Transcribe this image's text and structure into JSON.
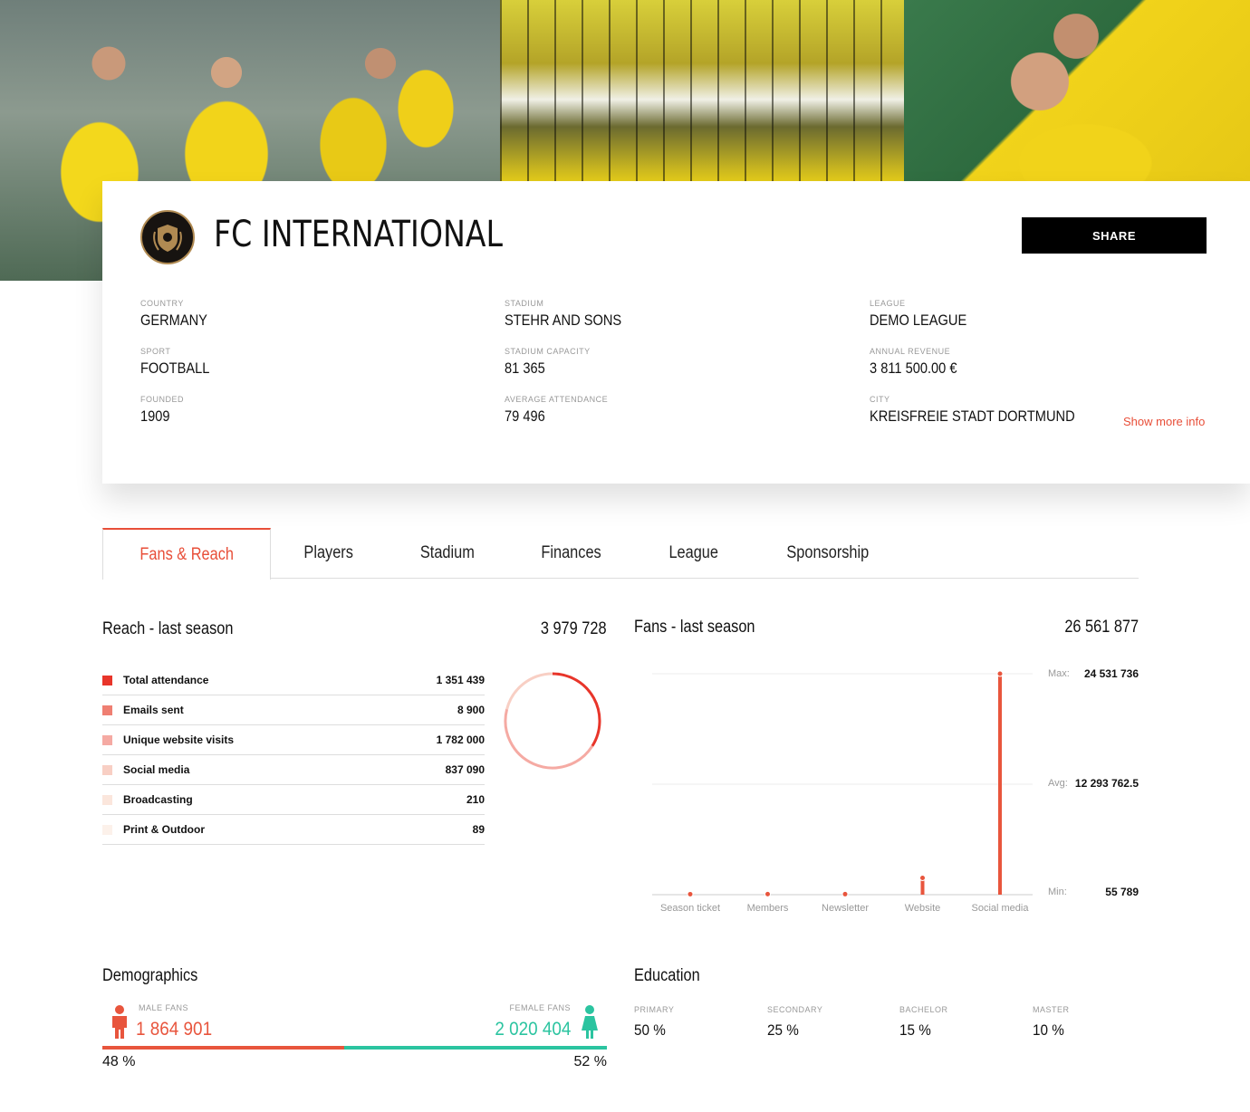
{
  "club": {
    "name": "FC INTERNATIONAL",
    "share_label": "SHARE",
    "show_more_label": "Show more info"
  },
  "info": {
    "col1": [
      {
        "label": "COUNTRY",
        "value": "GERMANY"
      },
      {
        "label": "SPORT",
        "value": "FOOTBALL"
      },
      {
        "label": "FOUNDED",
        "value": "1909"
      }
    ],
    "col2": [
      {
        "label": "STADIUM",
        "value": "STEHR AND SONS"
      },
      {
        "label": "STADIUM CAPACITY",
        "value": "81 365"
      },
      {
        "label": "AVERAGE ATTENDANCE",
        "value": "79 496"
      }
    ],
    "col3": [
      {
        "label": "LEAGUE",
        "value": "DEMO LEAGUE"
      },
      {
        "label": "ANNUAL REVENUE",
        "value": "3 811 500.00 €"
      },
      {
        "label": "CITY",
        "value": "KREISFREIE STADT DORTMUND"
      }
    ]
  },
  "tabs": [
    "Fans & Reach",
    "Players",
    "Stadium",
    "Finances",
    "League",
    "Sponsorship"
  ],
  "reach": {
    "title": "Reach - last season",
    "total": "3 979 728",
    "rows": [
      {
        "label": "Total attendance",
        "value": "1 351 439",
        "color": "#e8352a"
      },
      {
        "label": "Emails sent",
        "value": "8 900",
        "color": "#ef7f72"
      },
      {
        "label": "Unique website visits",
        "value": "1 782 000",
        "color": "#f5aaa3"
      },
      {
        "label": "Social media",
        "value": "837 090",
        "color": "#f8cfc4"
      },
      {
        "label": "Broadcasting",
        "value": "210",
        "color": "#fbe6dc"
      },
      {
        "label": "Print & Outdoor",
        "value": "89",
        "color": "#fcf1ea"
      }
    ]
  },
  "fans": {
    "title": "Fans - last season",
    "total": "26 561 877",
    "max_label": "Max:",
    "max_value": "24 531 736",
    "avg_label": "Avg:",
    "avg_value": "12 293 762.5",
    "min_label": "Min:",
    "min_value": "55 789"
  },
  "chart_data": {
    "type": "bar",
    "categories": [
      "Season ticket",
      "Members",
      "Newsletter",
      "Website",
      "Social media"
    ],
    "values": [
      55789,
      60000,
      58000,
      1860000,
      24531736
    ],
    "ylim": [
      0,
      24531736
    ],
    "grid": true
  },
  "demographics": {
    "title": "Demographics",
    "male_label": "MALE FANS",
    "male_value": "1 864 901",
    "male_pct": "48 %",
    "female_label": "FEMALE FANS",
    "female_value": "2 020 404",
    "female_pct": "52 %",
    "male_color": "#e8553d",
    "female_color": "#2bc4a0"
  },
  "education": {
    "title": "Education",
    "items": [
      {
        "label": "PRIMARY",
        "value": "50 %"
      },
      {
        "label": "SECONDARY",
        "value": "25 %"
      },
      {
        "label": "BACHELOR",
        "value": "15 %"
      },
      {
        "label": "MASTER",
        "value": "10 %"
      }
    ]
  }
}
